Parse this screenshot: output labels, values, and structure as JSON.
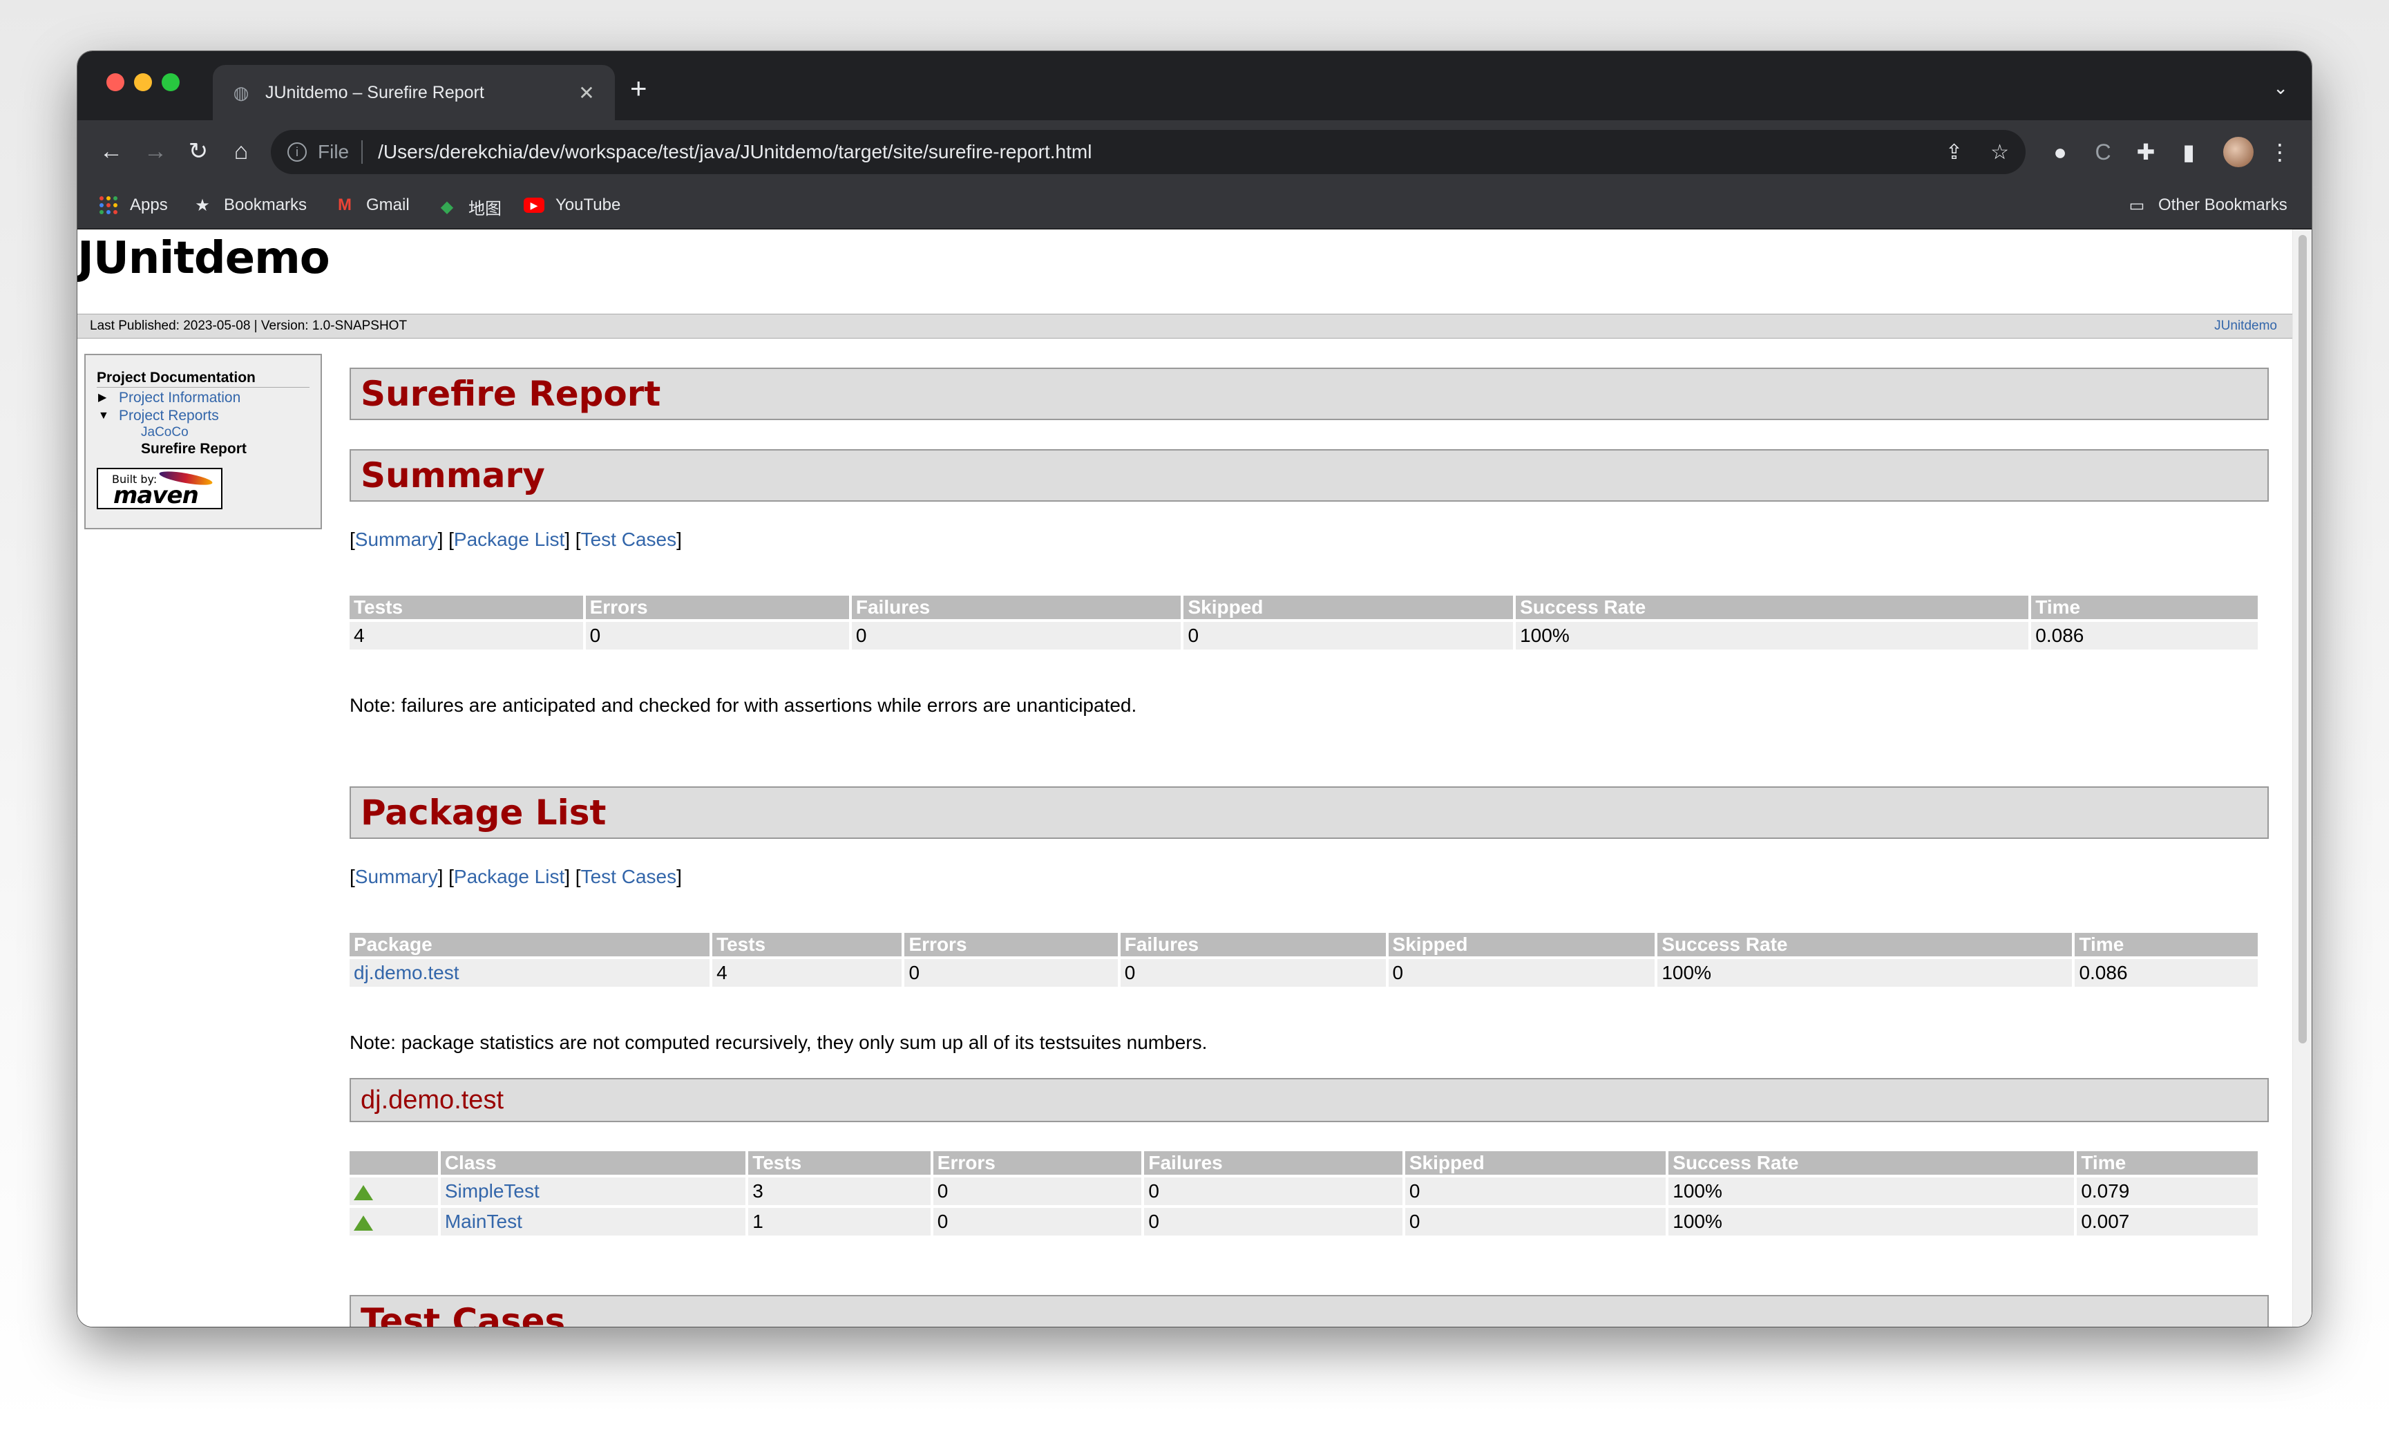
{
  "browser": {
    "tab_title": "JUnitdemo – Surefire Report",
    "omnibox_scheme": "File",
    "url": "/Users/derekchia/dev/workspace/test/java/JUnitdemo/target/site/surefire-report.html",
    "bookmarks": {
      "apps": "Apps",
      "bookmarks": "Bookmarks",
      "gmail": "Gmail",
      "maps": "地图",
      "youtube": "YouTube",
      "other": "Other Bookmarks"
    }
  },
  "site": {
    "banner": "JUnitdemo",
    "breadcrumbs": "Last Published: 2023-05-08 | Version: 1.0-SNAPSHOT",
    "breadcrumbs_right": "JUnitdemo"
  },
  "nav": {
    "heading": "Project Documentation",
    "project_information": "Project Information",
    "project_reports": "Project Reports",
    "jacoco": "JaCoCo",
    "surefire_report": "Surefire Report",
    "built_by": "Built by:",
    "maven": "maven"
  },
  "report": {
    "title": "Surefire Report",
    "summary_heading": "Summary",
    "package_list_heading": "Package List",
    "test_cases_heading": "Test Cases",
    "link_summary": "Summary",
    "link_package_list": "Package List",
    "link_test_cases": "Test Cases",
    "summary": {
      "headers": [
        "Tests",
        "Errors",
        "Failures",
        "Skipped",
        "Success Rate",
        "Time"
      ],
      "row": [
        "4",
        "0",
        "0",
        "0",
        "100%",
        "0.086"
      ]
    },
    "summary_note": "Note: failures are anticipated and checked for with assertions while errors are unanticipated.",
    "packages": {
      "headers": [
        "Package",
        "Tests",
        "Errors",
        "Failures",
        "Skipped",
        "Success Rate",
        "Time"
      ],
      "row": [
        "dj.demo.test",
        "4",
        "0",
        "0",
        "0",
        "100%",
        "0.086"
      ]
    },
    "package_note": "Note: package statistics are not computed recursively, they only sum up all of its testsuites numbers.",
    "package_heading": "dj.demo.test",
    "classes": {
      "headers": [
        "",
        "Class",
        "Tests",
        "Errors",
        "Failures",
        "Skipped",
        "Success Rate",
        "Time"
      ],
      "rows": [
        [
          "SimpleTest",
          "3",
          "0",
          "0",
          "0",
          "100%",
          "0.079"
        ],
        [
          "MainTest",
          "1",
          "0",
          "0",
          "0",
          "100%",
          "0.007"
        ]
      ]
    }
  },
  "colors": {
    "heading_red": "#990000",
    "link_blue": "#3366aa",
    "chrome_dark": "#202124",
    "chrome_toolbar": "#35363a"
  }
}
